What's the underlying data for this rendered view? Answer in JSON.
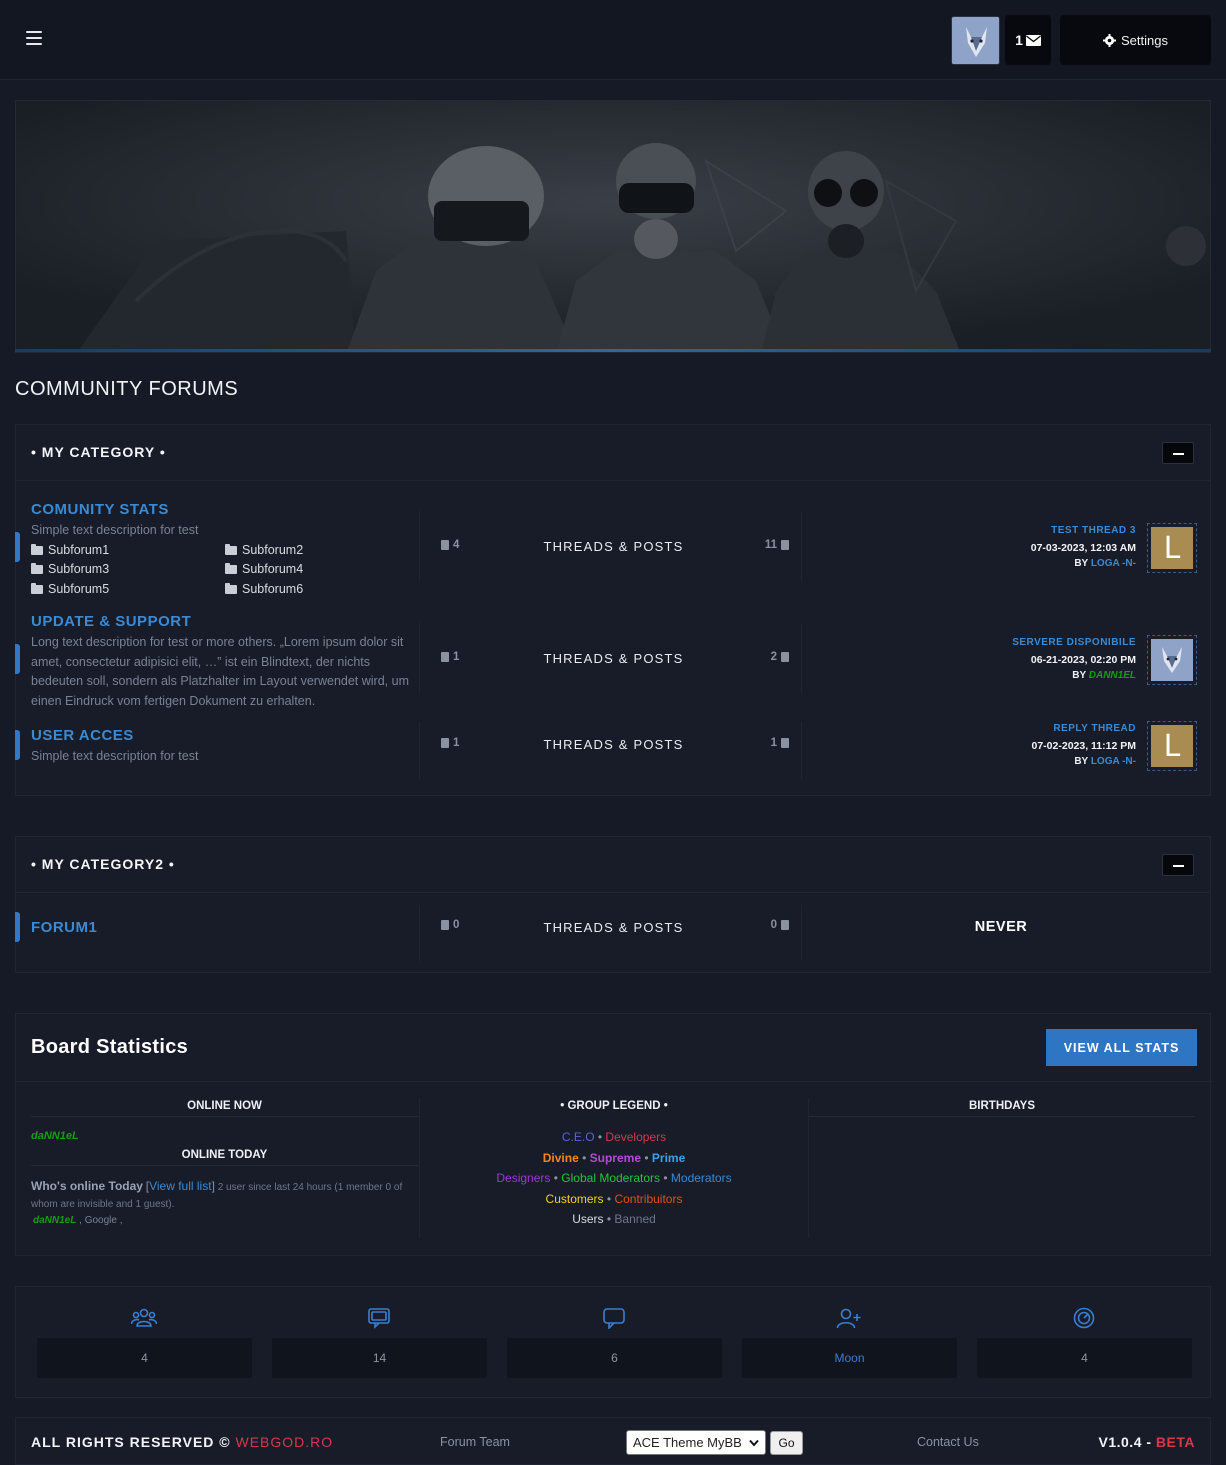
{
  "header": {
    "menu_icon": "hamburger-icon",
    "message_count": "1",
    "settings_label": "Settings"
  },
  "page": {
    "title": "COMMUNITY FORUMS"
  },
  "colors": {
    "accent_blue": "#2f79c8",
    "link_blue": "#3a8ad4",
    "brand_red": "#d23a4a",
    "online_green": "#1a9a1a"
  },
  "category1": {
    "title": "• MY CATEGORY •",
    "forums": [
      {
        "name": "COMUNITY STATS",
        "description": "Simple text description for test",
        "subforums": [
          "Subforum1",
          "Subforum2",
          "Subforum3",
          "Subforum4",
          "Subforum5",
          "Subforum6"
        ],
        "threads": "4",
        "label": "THREADS & POSTS",
        "posts": "11",
        "last_title": "TEST THREAD 3",
        "last_date": "07-03-2023, 12:03 AM",
        "last_by_prefix": "BY",
        "last_user": "LOGA -N-",
        "avatar_letter": "L"
      },
      {
        "name": "UPDATE & SUPPORT",
        "description": "Long text description for test or more others. „Lorem ipsum dolor sit amet, consectetur adipisici elit, …” ist ein Blindtext, der nichts bedeuten soll, sondern als Platzhalter im Layout verwendet wird, um einen Eindruck vom fertigen Dokument zu erhalten.",
        "threads": "1",
        "label": "THREADS & POSTS",
        "posts": "2",
        "last_title": "SERVERE DISPONIBILE",
        "last_date": "06-21-2023, 02:20 PM",
        "last_by_prefix": "BY",
        "last_user": "DANN1EL"
      },
      {
        "name": "USER ACCES",
        "description": "Simple text description for test",
        "threads": "1",
        "label": "THREADS & POSTS",
        "posts": "1",
        "last_title": "REPLY THREAD",
        "last_date": "07-02-2023, 11:12 PM",
        "last_by_prefix": "BY",
        "last_user": "LOGA -N-",
        "avatar_letter": "L"
      }
    ]
  },
  "category2": {
    "title": "• MY CATEGORY2 •",
    "forum": {
      "name": "FORUM1",
      "threads": "0",
      "label": "THREADS & POSTS",
      "posts": "0",
      "last": "NEVER"
    }
  },
  "board_stats": {
    "title": "Board Statistics",
    "view_all": "VIEW ALL STATS",
    "online_now_heading": "ONLINE NOW",
    "online_now_user": "daNN1eL",
    "online_today_heading": "ONLINE TODAY",
    "whos_online_label": "Who's online Today",
    "view_full_list": "View full list",
    "online_summary": "2 user since last 24 hours (1 member 0 of whom are invisible and 1 guest).",
    "today_user": "daNN1eL",
    "today_guest": ", Google ,",
    "group_legend_heading": "• GROUP LEGEND •",
    "groups": {
      "ceo": "C.E.O",
      "developers": "Developers",
      "divine": "Divine",
      "supreme": "Supreme",
      "prime": "Prime",
      "designers": "Designers",
      "global_moderators": "Global Moderators",
      "moderators": "Moderators",
      "customers": "Customers",
      "contributors": "Contribuitors",
      "users": "Users",
      "banned": "Banned"
    },
    "birthdays_heading": "BIRTHDAYS"
  },
  "counters": [
    {
      "icon": "members-icon",
      "value": "4"
    },
    {
      "icon": "threads-icon",
      "value": "14"
    },
    {
      "icon": "posts-icon",
      "value": "6"
    },
    {
      "icon": "newest-member-icon",
      "value": "Moon"
    },
    {
      "icon": "online-icon",
      "value": "4"
    }
  ],
  "footer": {
    "rights": "ALL RIGHTS RESERVED ©",
    "brand": "WEBGOD.RO",
    "forum_team": "Forum Team",
    "theme_selected": "ACE Theme MyBB",
    "go": "Go",
    "contact": "Contact Us",
    "version": "V1.0.4 -",
    "beta": "BETA"
  }
}
